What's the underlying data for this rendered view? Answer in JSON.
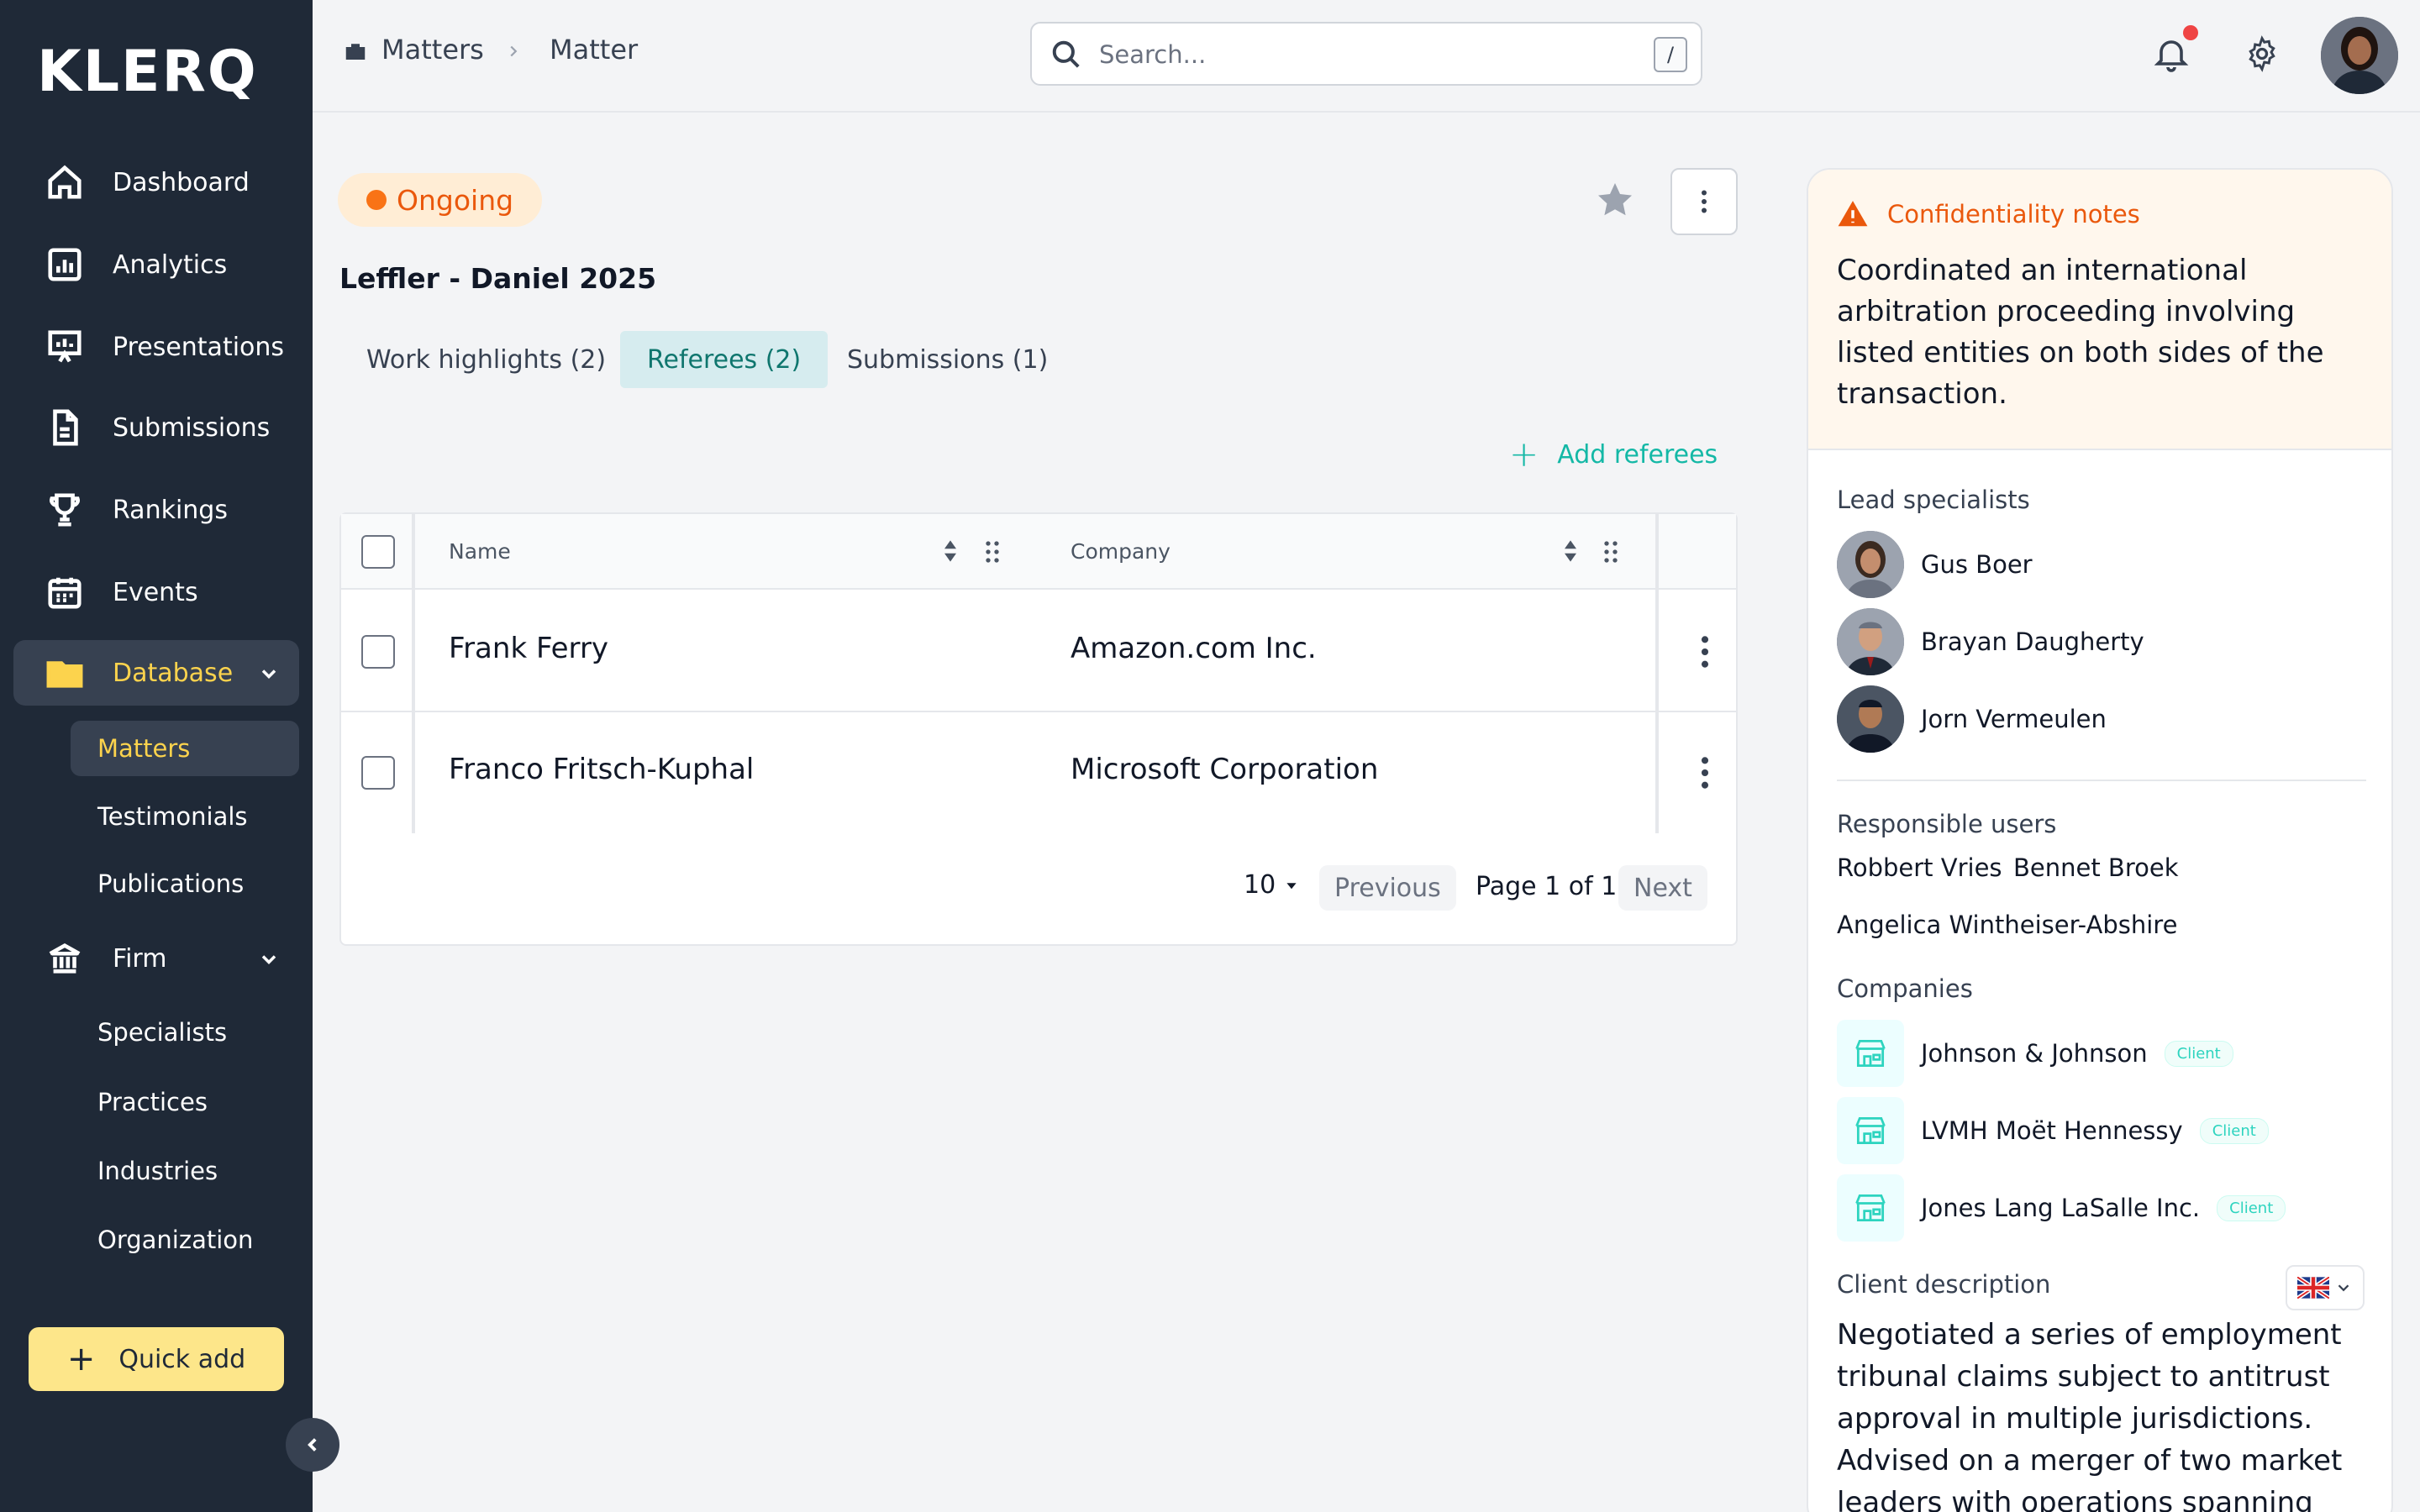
{
  "brand": {
    "logo_text": "KLERQ"
  },
  "sidebar": {
    "items": [
      {
        "label": "Dashboard",
        "icon": "home-icon"
      },
      {
        "label": "Analytics",
        "icon": "analytics-icon"
      },
      {
        "label": "Presentations",
        "icon": "presentation-icon"
      },
      {
        "label": "Submissions",
        "icon": "document-icon"
      },
      {
        "label": "Rankings",
        "icon": "trophy-icon"
      },
      {
        "label": "Events",
        "icon": "calendar-icon"
      },
      {
        "label": "Database",
        "icon": "folder-icon"
      },
      {
        "label": "Firm",
        "icon": "bank-icon"
      }
    ],
    "database_sub": [
      "Matters",
      "Testimonials",
      "Publications"
    ],
    "firm_sub": [
      "Specialists",
      "Practices",
      "Industries",
      "Organization"
    ],
    "quick_add": "Quick add"
  },
  "topbar": {
    "breadcrumb": [
      "Matters",
      "Matter"
    ],
    "search_placeholder": "Search...",
    "search_shortcut": "/"
  },
  "matter": {
    "status": "Ongoing",
    "title": "Leffler - Daniel 2025",
    "tabs": [
      "Work highlights (2)",
      "Referees (2)",
      "Submissions (1)"
    ],
    "active_tab": "Referees (2)",
    "add_referees": "Add referees"
  },
  "table": {
    "columns": [
      "Name",
      "Company"
    ],
    "rows": [
      {
        "name": "Frank Ferry",
        "company": "Amazon.com Inc."
      },
      {
        "name": "Franco Fritsch-Kuphal",
        "company": "Microsoft Corporation"
      }
    ],
    "page_size": "10",
    "prev_label": "Previous",
    "page_text": "Page 1 of 1",
    "next_label": "Next"
  },
  "panel": {
    "conf_title": "Confidentiality notes",
    "conf_text": "Coordinated an international arbitration proceeding involving listed entities on both sides of the transaction.",
    "lead_label": "Lead specialists",
    "leads": [
      "Gus Boer",
      "Brayan Daugherty",
      "Jorn Vermeulen"
    ],
    "responsible_label": "Responsible users",
    "responsible": [
      "Robbert Vries",
      "Bennet Broek",
      "Angelica Wintheiser-Abshire"
    ],
    "companies_label": "Companies",
    "companies": [
      {
        "name": "Johnson & Johnson",
        "badge": "Client"
      },
      {
        "name": "LVMH Moët Hennessy",
        "badge": "Client"
      },
      {
        "name": "Jones Lang LaSalle Inc.",
        "badge": "Client"
      }
    ],
    "client_desc_label": "Client description",
    "client_desc": "Negotiated a series of employment tribunal claims subject to antitrust approval in multiple jurisdictions. Advised on a merger of two market leaders with operations spanning"
  },
  "colors": {
    "sidebar_bg": "#1f2937",
    "accent_yellow": "#fcd34d",
    "status_orange": "#ea580c",
    "teal": "#14b8a6"
  }
}
